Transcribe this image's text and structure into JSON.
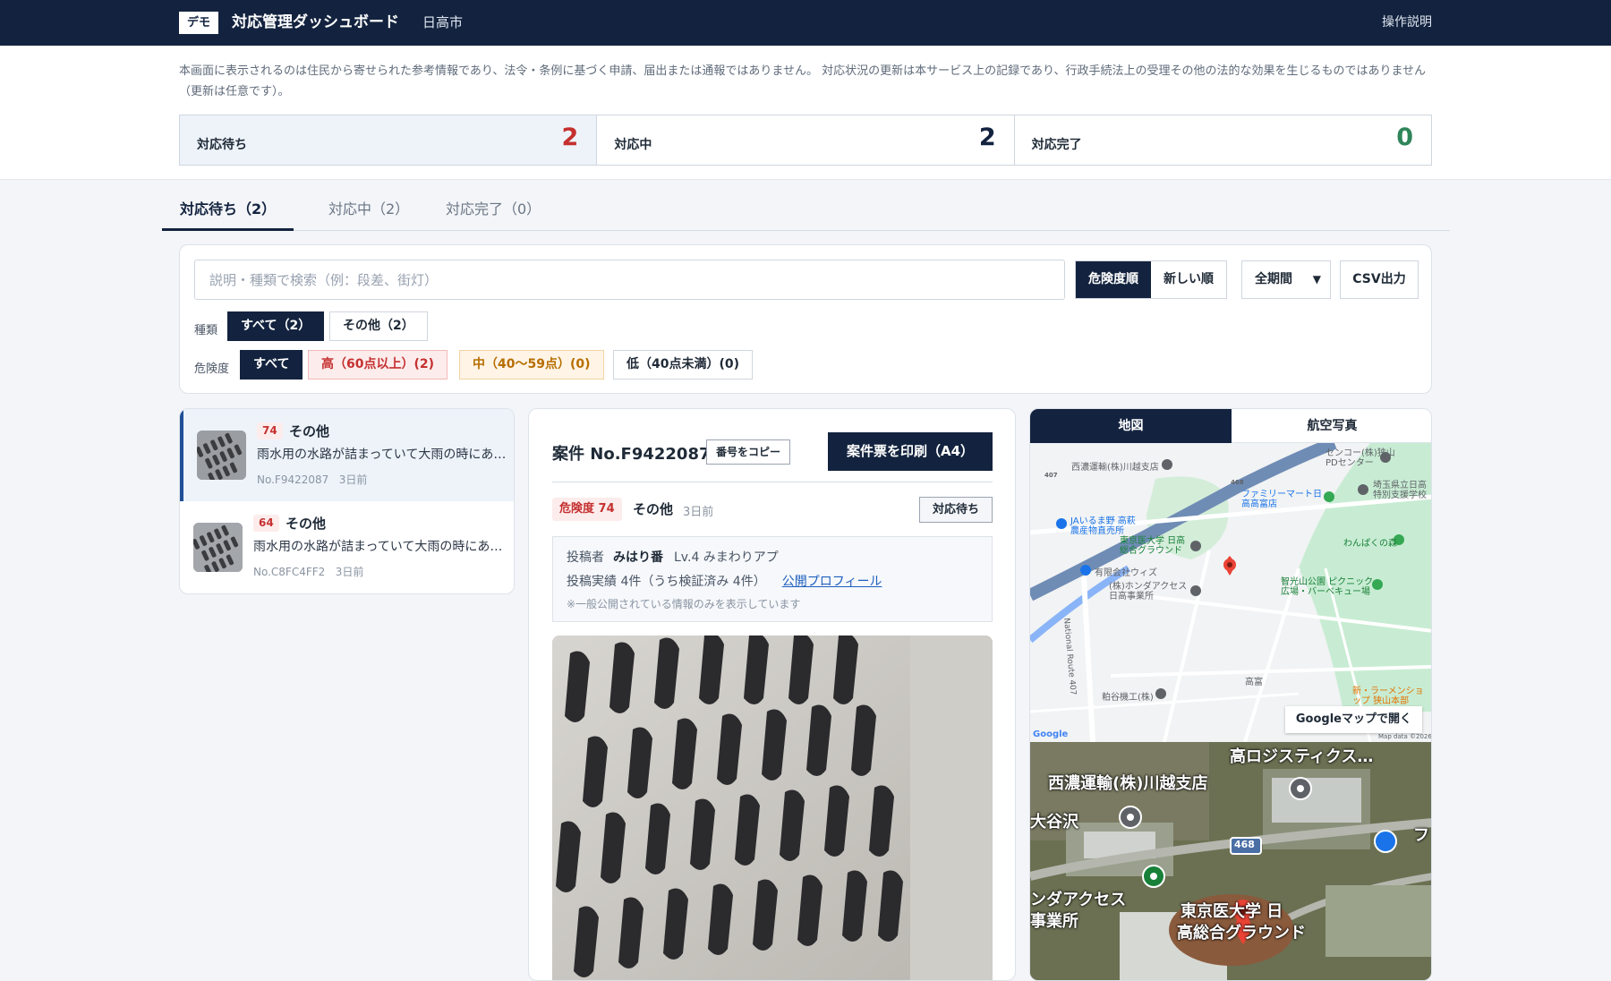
{
  "header": {
    "demo_badge": "デモ",
    "title": "対応管理ダッシュボード",
    "city": "日高市",
    "help": "操作説明"
  },
  "notice": "本画面に表示されるのは住民から寄せられた参考情報であり、法令・条例に基づく申請、届出または通報ではありません。 対応状況の更新は本サービス上の記録であり、行政手続法上の受理その他の法的な効果を生じるものではありません（更新は任意です）。",
  "stats": [
    {
      "label": "対応待ち",
      "value": "2",
      "color": "#c53030"
    },
    {
      "label": "対応中",
      "value": "2",
      "color": "#13233f"
    },
    {
      "label": "対応完了",
      "value": "0",
      "color": "#2f855a"
    }
  ],
  "tabs": [
    "対応待ち（2）",
    "対応中（2）",
    "対応完了（0）"
  ],
  "filters": {
    "search_placeholder": "説明・種類で検索（例：段差、街灯）",
    "sort_risk": "危険度順",
    "sort_new": "新しい順",
    "period": "全期間",
    "csv": "CSV出力",
    "type_label": "種類",
    "type_all": "すべて（2）",
    "type_other": "その他（2）",
    "risk_label": "危険度",
    "risk_all": "すべて",
    "risk_high": "高（60点以上）(2)",
    "risk_mid": "中（40〜59点）(0)",
    "risk_low": "低（40点未満）(0)"
  },
  "list": [
    {
      "score": "74",
      "type": "その他",
      "desc": "雨水用の水路が詰まっていて大雨の時にあふれます",
      "no": "No.F9422087",
      "time": "3日前"
    },
    {
      "score": "64",
      "type": "その他",
      "desc": "雨水用の水路が詰まっていて大雨の時にあふれます",
      "no": "No.C8FC4FF2",
      "time": "3日前"
    }
  ],
  "detail": {
    "case_no": "案件 No.F9422087",
    "copy": "番号をコピー",
    "print": "案件票を印刷（A4）",
    "risk": "危険度 74",
    "type": "その他",
    "time": "3日前",
    "status": "対応待ち",
    "poster_label": "投稿者",
    "poster_name": "みはり番",
    "poster_level": "Lv.4 みまわりアプ",
    "record": "投稿実績 4件（うち検証済み 4件）",
    "profile_link": "公開プロフィール",
    "note": "※一般公開されている情報のみを表示しています"
  },
  "map": {
    "tab_map": "地図",
    "tab_aerial": "航空写真",
    "open_gmap": "Googleマップで開く",
    "labels": {
      "seino": "西濃運輸(株)川越支店",
      "sencor": "センコー(株)狭山PDセンター",
      "saitama": "埼玉県立日高特別支援学校",
      "family": "ファミリーマート日高高富店",
      "ja": "JAいるま野 高萩農産物直売所",
      "tokyo_univ": "東京医大学 日高総合グラウンド",
      "wiz": "有限会社ウィズ",
      "honda": "(株)ホンダアクセス日高事業所",
      "wanpaku": "わんぱくの森",
      "chikoyama": "智光山公園 ピクニック広場・バーベキュー場",
      "road407": "National Route 407",
      "takatomi": "高富",
      "awaya": "粕谷機工(株)",
      "ramen": "新・ラーメンショップ 狭山本部",
      "google": "Google",
      "mapdata": "Map data ©2026",
      "r468": "468",
      "r407": "407"
    },
    "aerial_labels": {
      "takaguchi": "高ロジスティクス…",
      "seino": "西濃運輸(株)川越支店",
      "oyazawa": "大谷沢",
      "r468": "468",
      "honda": "ンダアクセス",
      "jigyosho": "事業所",
      "tokyo": "東京医大学 日",
      "ground": "高総合グラウンド",
      "fa": "フ"
    }
  }
}
